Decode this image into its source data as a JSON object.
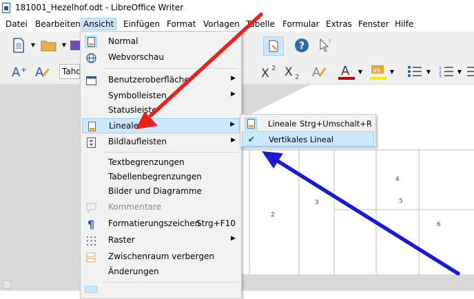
{
  "window": {
    "title": "181001_Hezelhof.odt - LibreOffice Writer"
  },
  "menubar": {
    "items": [
      {
        "label": "Datei"
      },
      {
        "label": "Bearbeiten"
      },
      {
        "label": "Ansicht",
        "active": true
      },
      {
        "label": "Einfügen"
      },
      {
        "label": "Format"
      },
      {
        "label": "Vorlagen"
      },
      {
        "label": "Tabelle"
      },
      {
        "label": "Formular"
      },
      {
        "label": "Extras"
      },
      {
        "label": "Fenster"
      },
      {
        "label": "Hilfe"
      }
    ]
  },
  "toolbar": {
    "font_name": "Taho"
  },
  "view_menu": {
    "items": [
      {
        "label": "Normal",
        "icon": "page-view-icon"
      },
      {
        "label": "Webvorschau",
        "icon": "globe-icon"
      },
      {
        "label": "Benutzeroberfläche",
        "icon": "window-icon",
        "submenu": true
      },
      {
        "label": "Symbolleisten",
        "submenu": true
      },
      {
        "label": "Statusleiste"
      },
      {
        "label": "Lineale",
        "icon": "ruler-doc-icon",
        "submenu": true,
        "highlighted": true
      },
      {
        "label": "Bildlaufleisten",
        "icon": "scrollbar-icon",
        "submenu": true
      },
      {
        "label": "Textbegrenzungen"
      },
      {
        "label": "Tabellenbegrenzungen"
      },
      {
        "label": "Bilder und Diagramme"
      },
      {
        "label": "Kommentare",
        "icon": "comment-icon",
        "disabled": true
      },
      {
        "label": "Formatierungszeichen",
        "icon": "pilcrow-icon",
        "shortcut": "Strg+F10"
      },
      {
        "label": "Raster",
        "icon": "grid-icon",
        "submenu": true
      },
      {
        "label": "Zwischenraum verbergen",
        "icon": "hide-whitespace-icon"
      },
      {
        "label": "Änderungen"
      }
    ]
  },
  "rulers_submenu": {
    "items": [
      {
        "label": "Lineale",
        "shortcut": "Strg+Umschalt+R",
        "icon": "ruler-doc-icon"
      },
      {
        "label": "Vertikales Lineal",
        "icon": "check-icon",
        "checked": true,
        "highlighted": true
      }
    ]
  },
  "document": {
    "numbers": [
      "2",
      "3",
      "4",
      "5",
      "6"
    ]
  },
  "colors": {
    "highlight": "#cce8ff",
    "arrow_red": "#e8231d",
    "arrow_blue": "#1a1ad6",
    "font_color": "#c00000",
    "highlight_color": "#ffe600"
  }
}
